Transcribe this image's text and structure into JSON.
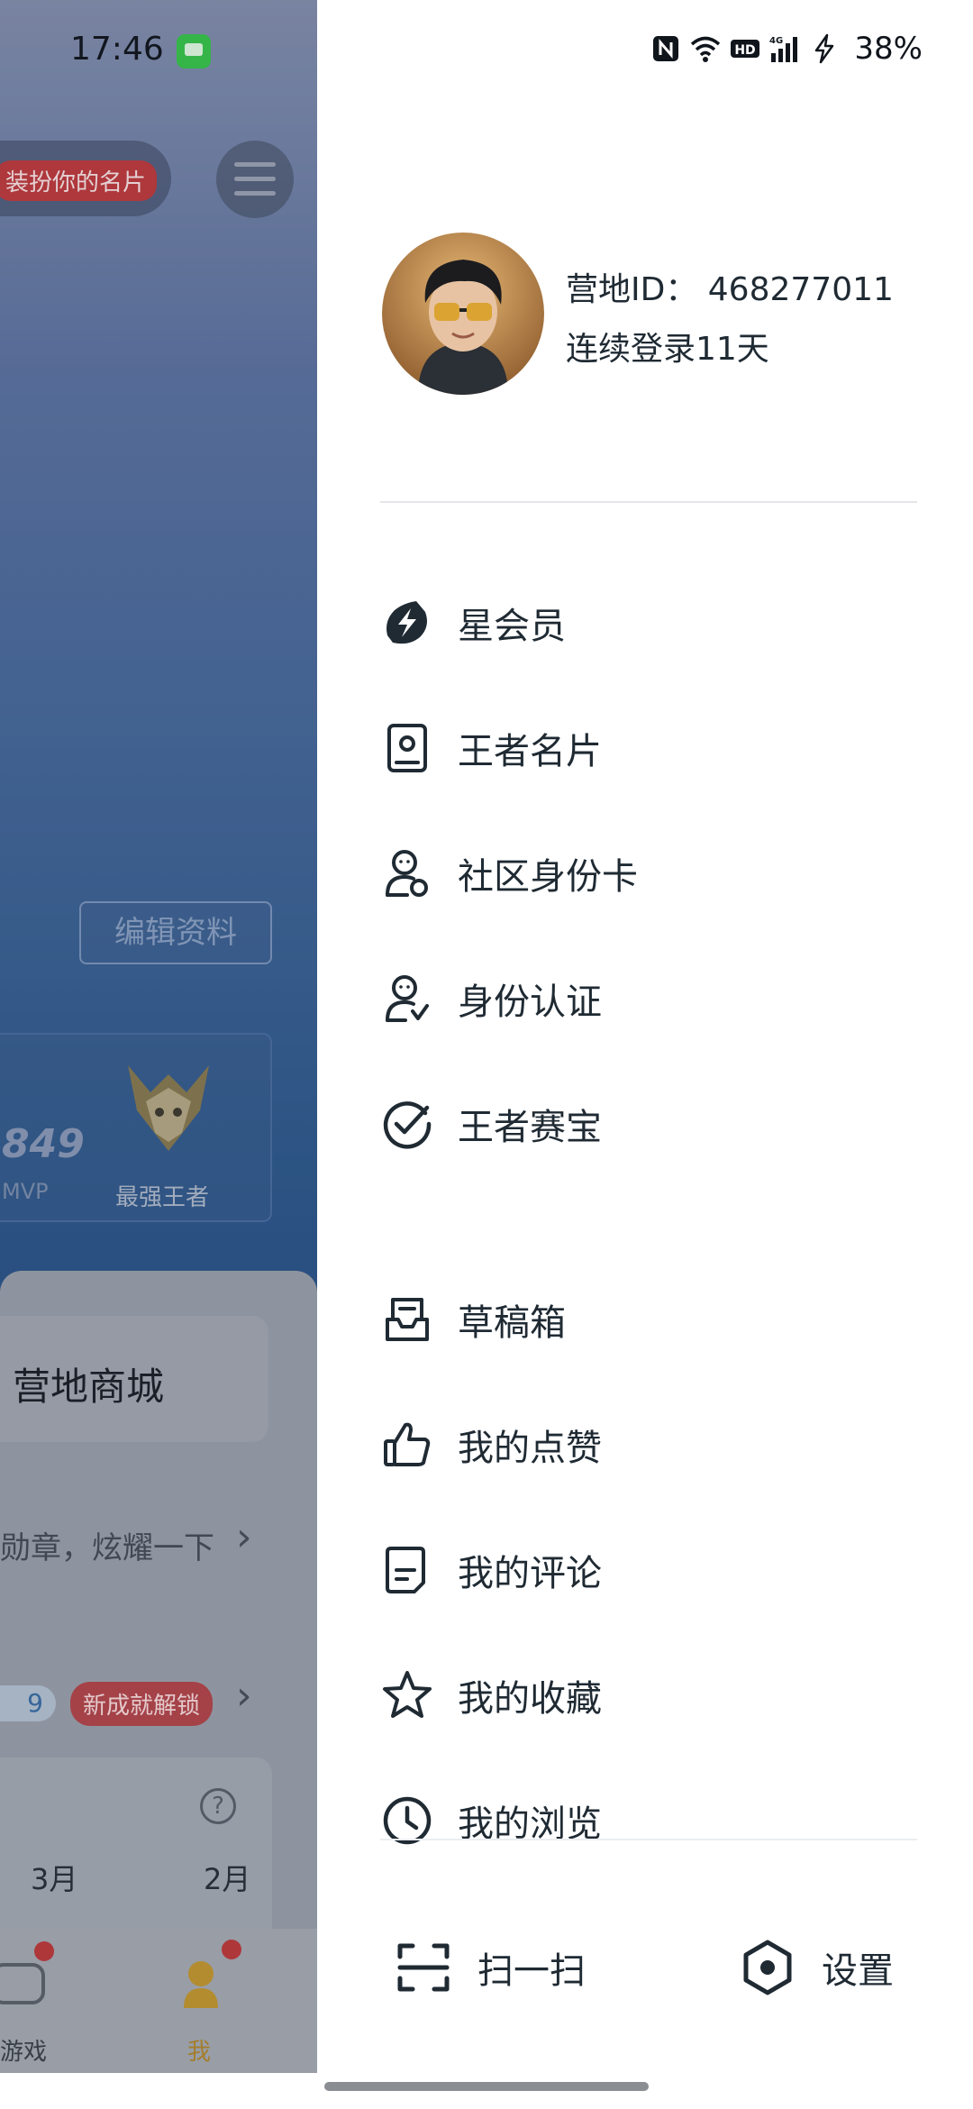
{
  "status_bar": {
    "time": "17:46",
    "battery": "38%",
    "icons": [
      "nfc-icon",
      "wifi-icon",
      "hd-icon",
      "signal-4g-icon",
      "charging-icon"
    ]
  },
  "background_page": {
    "dress_up_text": "装扮你的名片",
    "edit_profile": "编辑资料",
    "mvp_count": "849",
    "mvp_label": "MVP",
    "rank_label": "最强王者",
    "mall_label": "营地商城",
    "medal_text": "勋章，炫耀一下",
    "badge_count": "9",
    "new_achievement": "新成就解锁",
    "month_1": "3月",
    "month_2": "2月",
    "tab_game": "游戏",
    "tab_me": "我"
  },
  "profile": {
    "camp_id": "营地ID：  468277011",
    "login_days": "连续登录11天"
  },
  "menu": {
    "star_member": "星会员",
    "king_card": "王者名片",
    "community_id_card": "社区身份卡",
    "identity_verification": "身份认证",
    "king_esports": "王者赛宝",
    "drafts": "草稿箱",
    "my_likes": "我的点赞",
    "my_comments": "我的评论",
    "my_favorites": "我的收藏",
    "my_history": "我的浏览"
  },
  "bottom": {
    "scan": "扫一扫",
    "settings": "设置"
  },
  "colors": {
    "drawer_bg": "#ffffff",
    "text_primary": "#1f2a33",
    "accent_red": "#c2393b",
    "background_blue": "#2f5b8f"
  }
}
